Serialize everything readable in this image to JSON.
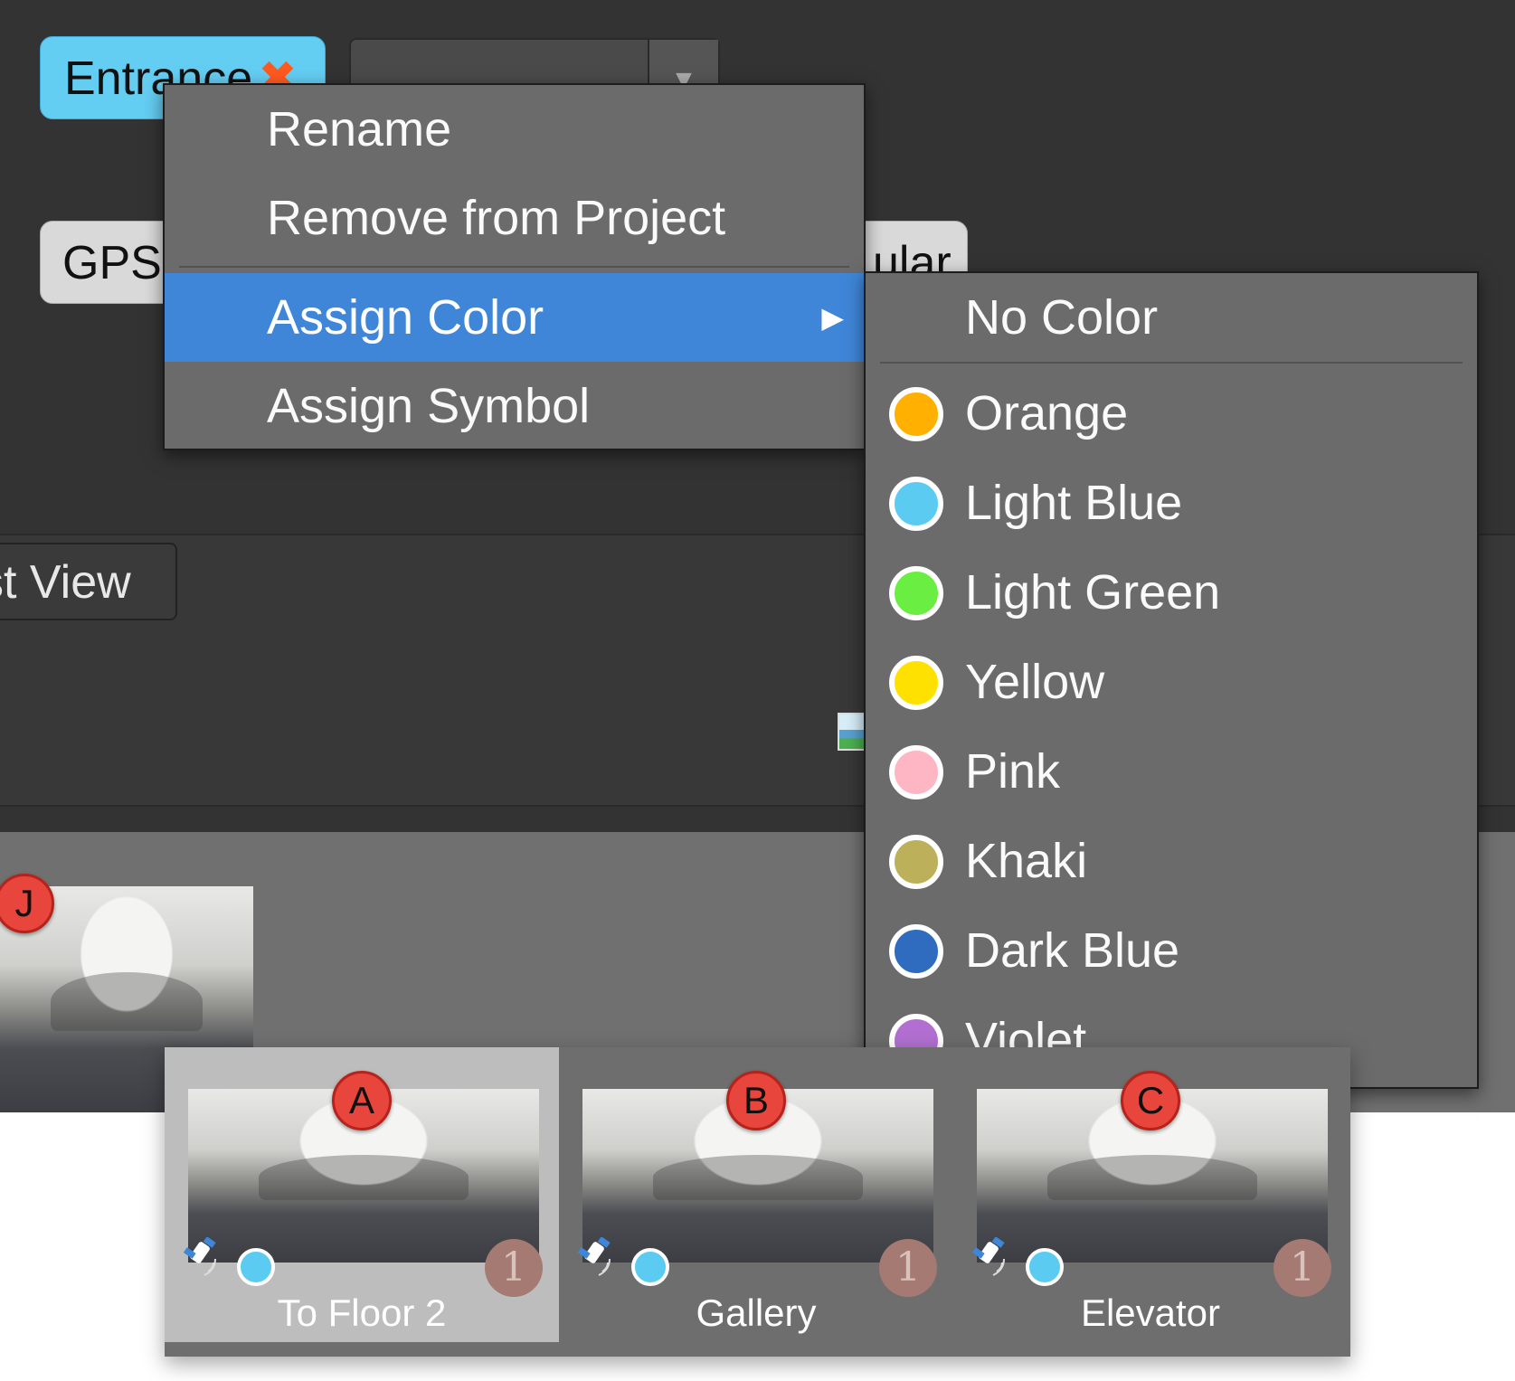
{
  "top": {
    "tag_entrance": "Entrance",
    "tag_remove_symbol": "✖",
    "gps_button": "GPS",
    "equirect_button": "ular",
    "view_tab": "st View",
    "combo_arrow": "▼"
  },
  "context_menu": {
    "items": [
      {
        "label": "Rename"
      },
      {
        "label": "Remove from Project"
      },
      {
        "label": "Assign Color",
        "has_submenu": true,
        "active": true
      },
      {
        "label": "Assign Symbol"
      }
    ],
    "submenu_arrow": "▶"
  },
  "color_submenu": {
    "no_color": "No Color",
    "colors": [
      {
        "label": "Orange",
        "hex": "#ffb000"
      },
      {
        "label": "Light Blue",
        "hex": "#5ccbf2"
      },
      {
        "label": "Light Green",
        "hex": "#6aee42"
      },
      {
        "label": "Yellow",
        "hex": "#ffe100"
      },
      {
        "label": "Pink",
        "hex": "#ffb6c4"
      },
      {
        "label": "Khaki",
        "hex": "#bcb05a"
      },
      {
        "label": "Dark Blue",
        "hex": "#2f6cbf"
      },
      {
        "label": "Violet",
        "hex": "#b26fd1"
      }
    ]
  },
  "side_panorama": {
    "badge": "J"
  },
  "thumbnails": [
    {
      "badge": "A",
      "label": "To Floor 2",
      "count": "1",
      "selected": true
    },
    {
      "badge": "B",
      "label": "Gallery",
      "count": "1",
      "selected": false
    },
    {
      "badge": "C",
      "label": "Elevator",
      "count": "1",
      "selected": false
    }
  ],
  "icons": {
    "gps": "satellite-icon"
  }
}
